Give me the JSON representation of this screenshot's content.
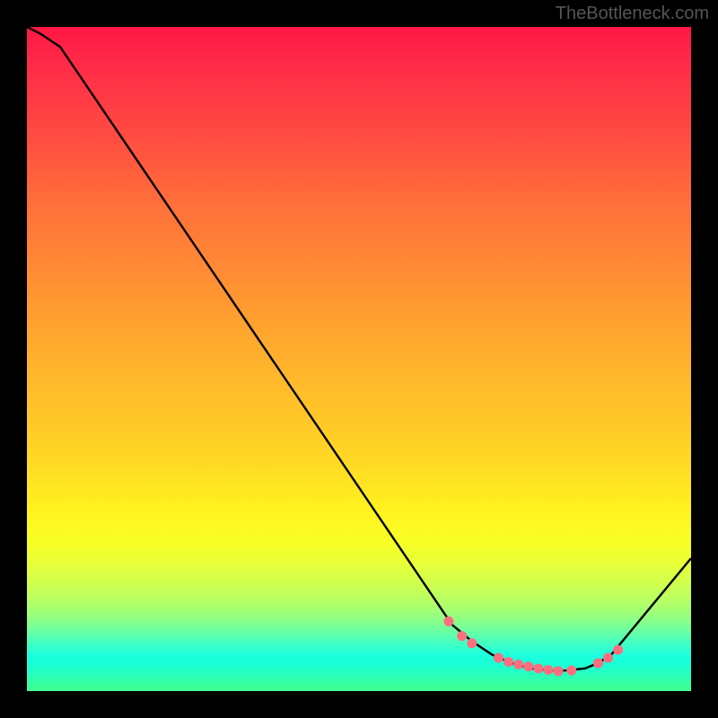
{
  "attribution": "TheBottleneck.com",
  "chart_data": {
    "type": "line",
    "title": "",
    "xlabel": "",
    "ylabel": "",
    "ylim": [
      0,
      100
    ],
    "xlim": [
      0,
      100
    ],
    "series": [
      {
        "name": "curve",
        "x": [
          0,
          2,
          5,
          64,
          67,
          70,
          73,
          76,
          80,
          84,
          86,
          88,
          100
        ],
        "y": [
          100,
          99,
          97,
          10,
          7.5,
          5.5,
          4.2,
          3.4,
          3.0,
          3.4,
          4.2,
          5.5,
          20
        ]
      }
    ],
    "markers": {
      "name": "dots",
      "color": "#ff6e7f",
      "x": [
        63.5,
        65.5,
        67,
        71,
        72.5,
        74,
        75.5,
        77,
        78.5,
        80,
        82,
        86,
        87.5,
        89
      ],
      "y": [
        10.5,
        8.3,
        7.2,
        5.0,
        4.4,
        4.0,
        3.7,
        3.4,
        3.2,
        3.0,
        3.1,
        4.2,
        5.0,
        6.2
      ]
    }
  }
}
